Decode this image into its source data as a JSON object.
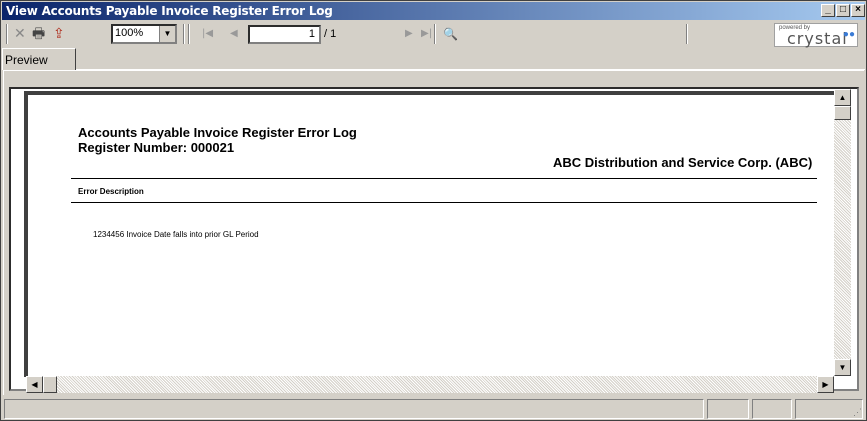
{
  "window": {
    "title": "View Accounts Payable Invoice Register Error Log",
    "minimize_glyph": "_",
    "maximize_glyph": "□",
    "close_glyph": "×"
  },
  "toolbar": {
    "close_glyph": "✕",
    "print_glyph": "🖶",
    "export_glyph": "⇪",
    "zoom_value": "100%",
    "first_glyph": "|◀",
    "prev_glyph": "◀",
    "page_current": "1",
    "page_total": "/ 1",
    "next_glyph": "▶",
    "last_glyph": "▶|",
    "find_glyph": "🔍",
    "logo_powered_by": "powered by",
    "logo_brand": "crystal"
  },
  "tabs": [
    {
      "label": "Preview"
    }
  ],
  "report": {
    "title": "Accounts Payable Invoice Register Error Log",
    "register_line": "Register Number: 000021",
    "company": "ABC Distribution and Service Corp. (ABC)",
    "column_header": "Error Description",
    "rows": [
      {
        "text": "1234456 Invoice Date falls into prior GL Period"
      }
    ]
  },
  "icons": {
    "scroll_up": "▲",
    "scroll_down": "▼",
    "scroll_left": "◀",
    "scroll_right": "▶"
  }
}
